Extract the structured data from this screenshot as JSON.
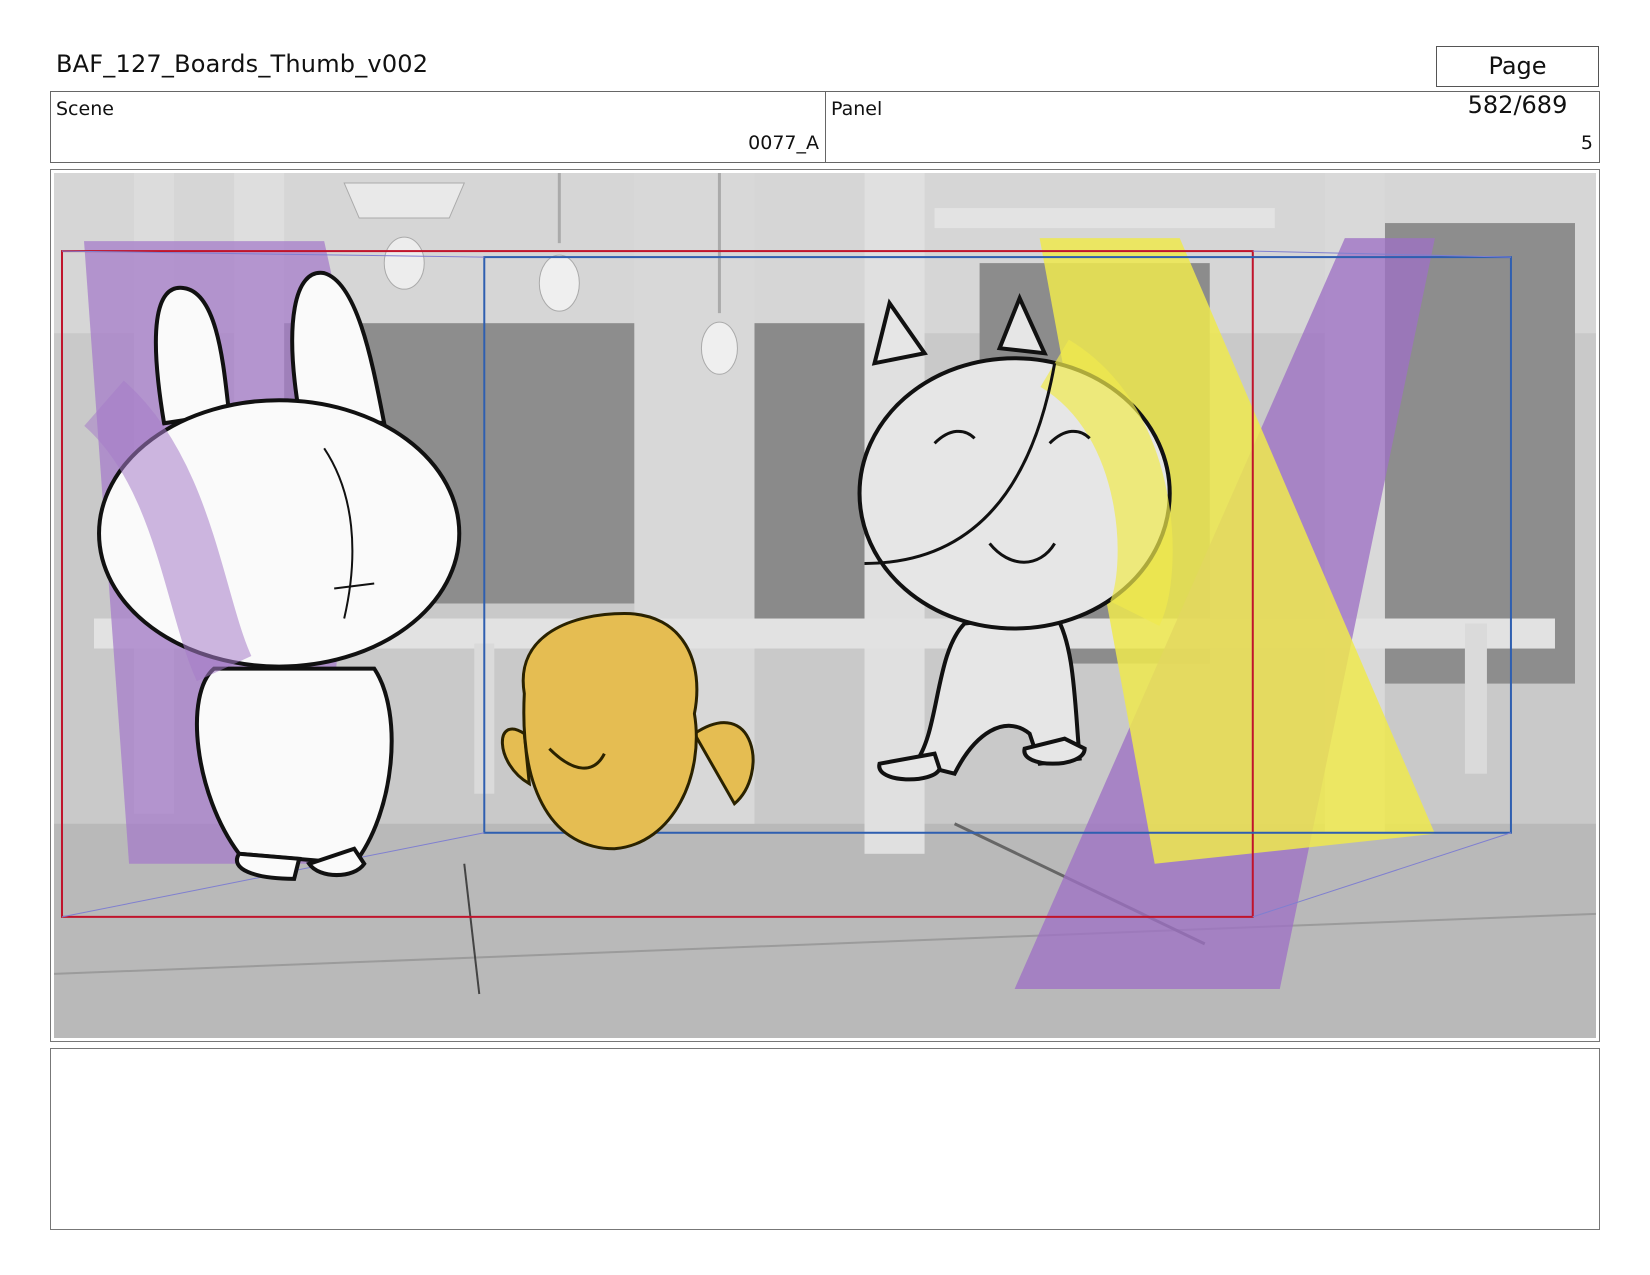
{
  "header": {
    "document_title": "BAF_127_Boards_Thumb_v002",
    "page_indicator": "Page 582/689"
  },
  "meta": {
    "scene_label": "Scene",
    "scene_value": "0077_A",
    "panel_label": "Panel",
    "panel_value": "5"
  },
  "panel_image": {
    "characters": [
      "bunny",
      "chick",
      "cat"
    ]
  },
  "notes": {
    "text": ""
  }
}
